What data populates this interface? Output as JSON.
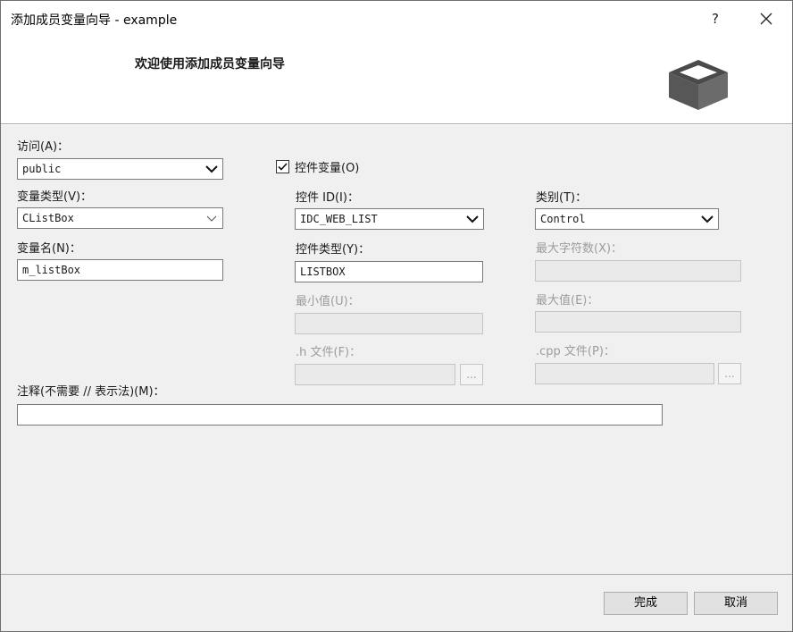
{
  "window": {
    "title": "添加成员变量向导 - example",
    "help_glyph": "?",
    "close_glyph": "✕"
  },
  "banner": {
    "heading": "欢迎使用添加成员变量向导",
    "icon": "box-icon"
  },
  "form": {
    "access": {
      "label": "访问(A)：",
      "value": "public"
    },
    "var_type": {
      "label": "变量类型(V)：",
      "value": "CListBox"
    },
    "var_name": {
      "label": "变量名(N)：",
      "value": "m_listBox"
    },
    "control_var": {
      "label": "控件变量(O)",
      "checked": true
    },
    "control_id": {
      "label": "控件 ID(I)：",
      "value": "IDC_WEB_LIST"
    },
    "control_type": {
      "label": "控件类型(Y)：",
      "value": "LISTBOX"
    },
    "min_value": {
      "label": "最小值(U)：",
      "value": ""
    },
    "h_file": {
      "label": ".h 文件(F)：",
      "value": "",
      "browse_label": "..."
    },
    "category": {
      "label": "类别(T)：",
      "value": "Control"
    },
    "max_chars": {
      "label": "最大字符数(X)：",
      "value": ""
    },
    "max_value": {
      "label": "最大值(E)：",
      "value": ""
    },
    "cpp_file": {
      "label": ".cpp 文件(P)：",
      "value": "",
      "browse_label": "..."
    },
    "comment": {
      "label": "注释(不需要 // 表示法)(M)：",
      "value": ""
    }
  },
  "footer": {
    "finish_label": "完成",
    "cancel_label": "取消"
  }
}
